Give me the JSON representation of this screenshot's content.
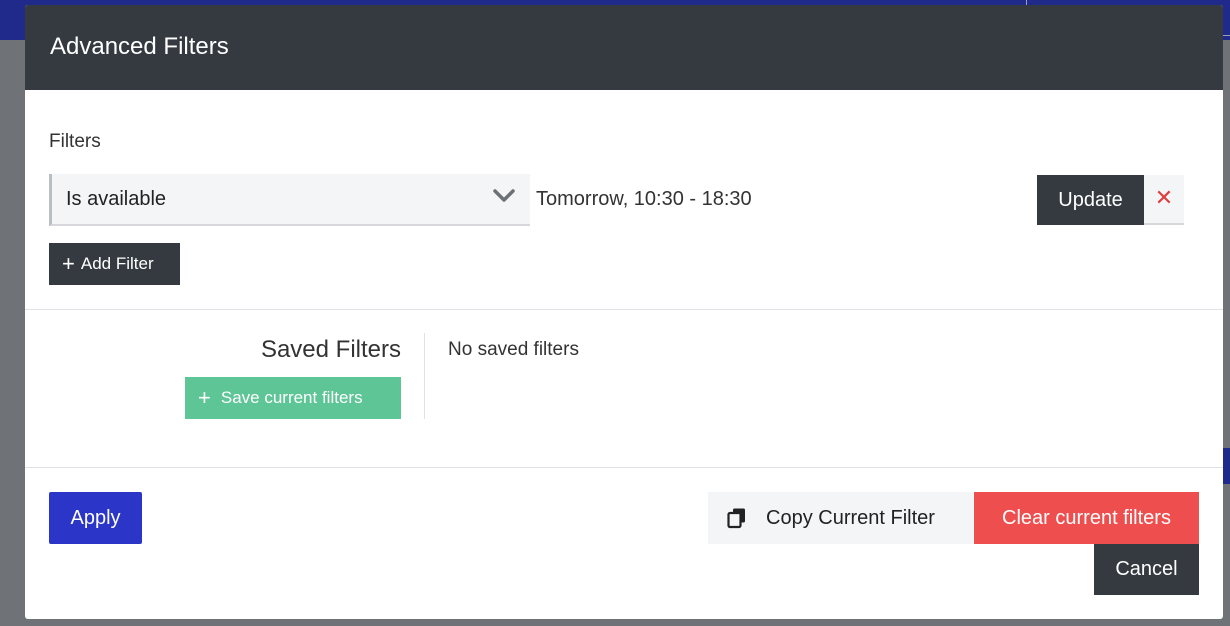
{
  "modal": {
    "title": "Advanced Filters"
  },
  "filters": {
    "label": "Filters",
    "rows": [
      {
        "type": "Is available",
        "value": "Tomorrow, 10:30 - 18:30",
        "update_label": "Update",
        "remove_symbol": "✕"
      }
    ],
    "add_filter_label": "Add Filter"
  },
  "saved_filters": {
    "title": "Saved Filters",
    "save_button_label": "Save current filters",
    "empty_text": "No saved filters"
  },
  "footer": {
    "apply_label": "Apply",
    "copy_label": "Copy Current Filter",
    "clear_label": "Clear current filters",
    "cancel_label": "Cancel"
  },
  "colors": {
    "header_bg": "#343a40",
    "primary": "#2b35c8",
    "success": "#5ec596",
    "danger": "#ef4e4e"
  },
  "icons": {
    "dropdown": "chevron-down-icon",
    "remove": "close-icon",
    "add": "plus-icon",
    "copy": "copy-icon"
  }
}
